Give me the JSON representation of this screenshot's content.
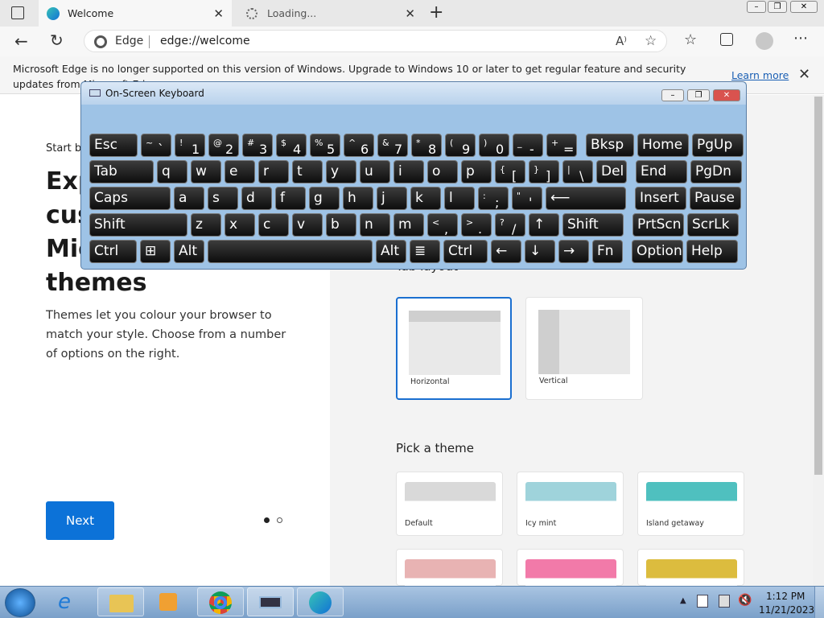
{
  "browser": {
    "tabs": [
      {
        "label": "Welcome"
      },
      {
        "label": "Loading..."
      }
    ],
    "address_site": "Edge",
    "address_url": "edge://welcome"
  },
  "infobar": {
    "message": "Microsoft Edge is no longer supported on this version of Windows. Upgrade to Windows 10 or later to get regular feature and security updates from Microsoft Edge.",
    "link": "Learn more"
  },
  "welcome": {
    "eyebrow": "Start b",
    "title_lines": [
      "Exp",
      "cus",
      "Mic",
      "themes"
    ],
    "description": "Themes let you colour your browser to match your style. Choose from a number of options on the right.",
    "next": "Next",
    "tab_layout_heading": "Tab layout",
    "layouts": [
      {
        "label": "Horizontal",
        "selected": true
      },
      {
        "label": "Vertical",
        "selected": false
      }
    ],
    "theme_heading": "Pick a theme",
    "themes": [
      {
        "label": "Default",
        "color": "#d9d9d9"
      },
      {
        "label": "Icy mint",
        "color": "#9fd3db"
      },
      {
        "label": "Island getaway",
        "color": "#4fc0bf"
      },
      {
        "label": "",
        "color": "#e8b3b3"
      },
      {
        "label": "",
        "color": "#f27aa9"
      },
      {
        "label": "",
        "color": "#dcbc3e"
      }
    ]
  },
  "osk": {
    "title": "On-Screen Keyboard",
    "rows": [
      [
        [
          "Esc",
          ""
        ],
        [
          "`",
          "~"
        ],
        [
          "1",
          "!"
        ],
        [
          "2",
          "@"
        ],
        [
          "3",
          "#"
        ],
        [
          "4",
          "$"
        ],
        [
          "5",
          "%"
        ],
        [
          "6",
          "^"
        ],
        [
          "7",
          "&"
        ],
        [
          "8",
          "*"
        ],
        [
          "9",
          "("
        ],
        [
          "0",
          ")"
        ],
        [
          "-",
          "_"
        ],
        [
          "=",
          "+"
        ],
        [
          "Bksp",
          ""
        ],
        [
          "Home",
          ""
        ],
        [
          "PgUp",
          ""
        ]
      ],
      [
        [
          "Tab",
          ""
        ],
        [
          "q",
          ""
        ],
        [
          "w",
          ""
        ],
        [
          "e",
          ""
        ],
        [
          "r",
          ""
        ],
        [
          "t",
          ""
        ],
        [
          "y",
          ""
        ],
        [
          "u",
          ""
        ],
        [
          "i",
          ""
        ],
        [
          "o",
          ""
        ],
        [
          "p",
          ""
        ],
        [
          "[",
          "{"
        ],
        [
          "]",
          "}"
        ],
        [
          "\\",
          "|"
        ],
        [
          "Del",
          ""
        ],
        [
          "End",
          ""
        ],
        [
          "PgDn",
          ""
        ]
      ],
      [
        [
          "Caps",
          ""
        ],
        [
          "a",
          ""
        ],
        [
          "s",
          ""
        ],
        [
          "d",
          ""
        ],
        [
          "f",
          ""
        ],
        [
          "g",
          ""
        ],
        [
          "h",
          ""
        ],
        [
          "j",
          ""
        ],
        [
          "k",
          ""
        ],
        [
          "l",
          ""
        ],
        [
          ";",
          ":"
        ],
        [
          "'",
          "\""
        ],
        [
          "⟵",
          ""
        ],
        [
          "Insert",
          ""
        ],
        [
          "Pause",
          ""
        ]
      ],
      [
        [
          "Shift",
          ""
        ],
        [
          "z",
          ""
        ],
        [
          "x",
          ""
        ],
        [
          "c",
          ""
        ],
        [
          "v",
          ""
        ],
        [
          "b",
          ""
        ],
        [
          "n",
          ""
        ],
        [
          "m",
          ""
        ],
        [
          ",",
          "<"
        ],
        [
          ".",
          ">"
        ],
        [
          "/",
          "?"
        ],
        [
          "↑",
          ""
        ],
        [
          "Shift",
          ""
        ],
        [
          "PrtScn",
          ""
        ],
        [
          "ScrLk",
          ""
        ]
      ],
      [
        [
          "Ctrl",
          ""
        ],
        [
          "⊞",
          ""
        ],
        [
          "Alt",
          ""
        ],
        [
          "",
          ""
        ],
        [
          "Alt",
          ""
        ],
        [
          "≣",
          ""
        ],
        [
          "Ctrl",
          ""
        ],
        [
          "←",
          ""
        ],
        [
          "↓",
          ""
        ],
        [
          "→",
          ""
        ],
        [
          "Fn",
          ""
        ],
        [
          "Options",
          ""
        ],
        [
          "Help",
          ""
        ]
      ]
    ]
  },
  "taskbar": {
    "time": "1:12 PM",
    "date": "11/21/2023"
  }
}
